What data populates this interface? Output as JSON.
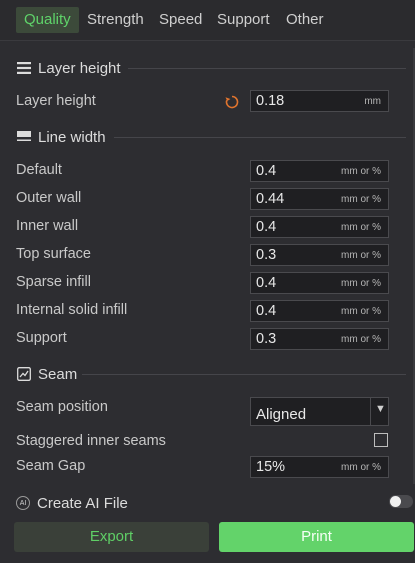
{
  "tabs": [
    {
      "label": "Quality",
      "active": true
    },
    {
      "label": "Strength"
    },
    {
      "label": "Speed"
    },
    {
      "label": "Support"
    },
    {
      "label": "Other"
    }
  ],
  "sections": {
    "layer_height": {
      "title": "Layer height",
      "icon": "lines-icon",
      "rows": [
        {
          "label": "Layer height",
          "value": "0.18",
          "unit": "mm"
        }
      ]
    },
    "line_width": {
      "title": "Line width",
      "icon": "line-width-icon",
      "rows": [
        {
          "label": "Default",
          "value": "0.4",
          "unit": "mm or %"
        },
        {
          "label": "Outer wall",
          "value": "0.44",
          "unit": "mm or %"
        },
        {
          "label": "Inner wall",
          "value": "0.4",
          "unit": "mm or %"
        },
        {
          "label": "Top surface",
          "value": "0.3",
          "unit": "mm or %"
        },
        {
          "label": "Sparse infill",
          "value": "0.4",
          "unit": "mm or %"
        },
        {
          "label": "Internal solid infill",
          "value": "0.4",
          "unit": "mm or %"
        },
        {
          "label": "Support",
          "value": "0.3",
          "unit": "mm or %"
        }
      ]
    },
    "seam": {
      "title": "Seam",
      "icon": "seam-icon",
      "position_label": "Seam position",
      "position_value": "Aligned",
      "staggered_label": "Staggered inner seams",
      "staggered_checked": false,
      "gap_label": "Seam Gap",
      "gap_value": "15%",
      "gap_unit": "mm or %"
    }
  },
  "ai_file": {
    "label": "Create AI File",
    "badge": "AI",
    "enabled": false
  },
  "buttons": {
    "export": "Export",
    "print": "Print"
  },
  "colors": {
    "accent": "#5fd36a",
    "background": "#2d2d31",
    "field": "#1f1f22",
    "reset": "#e0742e"
  }
}
